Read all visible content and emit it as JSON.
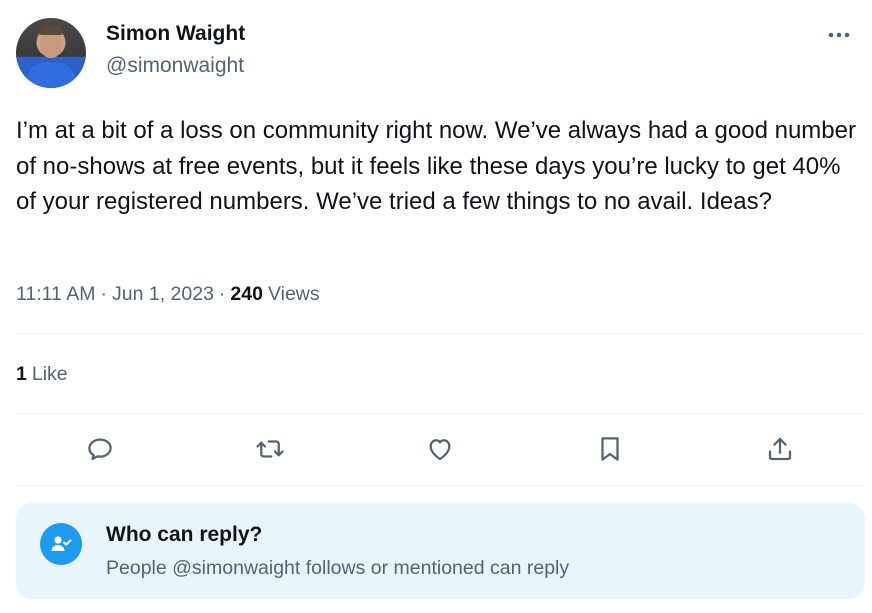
{
  "author": {
    "display_name": "Simon Waight",
    "handle": "@simonwaight"
  },
  "tweet": {
    "text": "I’m at a bit of a loss on community right now. We’ve always had a good number of no-shows at free events, but it feels like these days you’re lucky to get 40% of your registered numbers. We’ve tried a few things to no avail. Ideas?",
    "time": "11:11 AM",
    "separator_1": "·",
    "date": "Jun 1, 2023",
    "separator_2": "·",
    "views_count": "240",
    "views_label": "Views"
  },
  "engagement": {
    "likes_count": "1",
    "likes_label": "Like"
  },
  "actions": [
    {
      "icon": "reply-icon"
    },
    {
      "icon": "retweet-icon"
    },
    {
      "icon": "like-heart-icon"
    },
    {
      "icon": "bookmark-icon"
    },
    {
      "icon": "share-icon"
    }
  ],
  "reply_settings": {
    "icon": "user-check-icon",
    "title": "Who can reply?",
    "description": "People @simonwaight follows or mentioned can reply"
  },
  "colors": {
    "text_primary": "#0f1419",
    "text_secondary": "#536471",
    "accent": "#1d9bf0",
    "reply_box_bg": "#e8f5fd",
    "divider": "#eff3f4"
  }
}
